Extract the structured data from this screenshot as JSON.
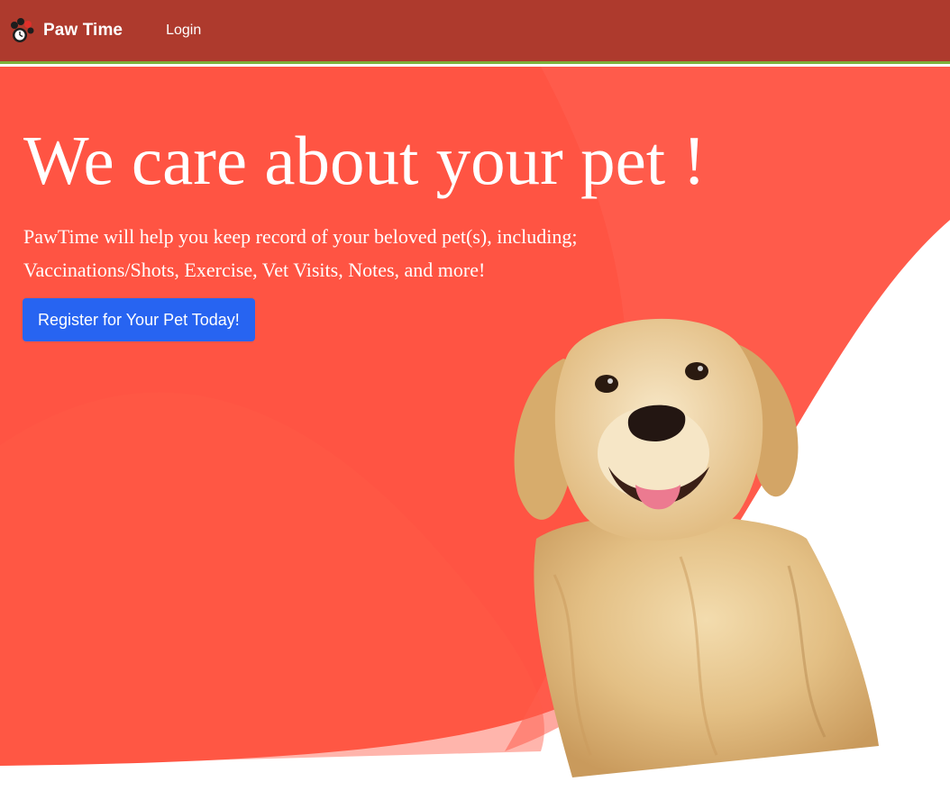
{
  "navbar": {
    "brand": "Paw Time",
    "brand_icon": "paw-clock-logo-icon",
    "links": [
      {
        "label": "Login"
      }
    ]
  },
  "hero": {
    "title": "We care about your pet !",
    "description_lines": [
      "PawTime will help you keep record of your beloved pet(s), including;",
      "Vaccinations/Shots, Exercise, Vet Visits, Notes, and more!"
    ],
    "cta_label": "Register for Your Pet Today!",
    "image": "golden-retriever-photo"
  },
  "colors": {
    "navbar_bg": "#ae3a2d",
    "navbar_border": "#7fb03a",
    "hero_red": "#ff5443",
    "hero_red_light": "#ff6152",
    "button_blue": "#2764f1",
    "text_white": "#ffffff"
  }
}
